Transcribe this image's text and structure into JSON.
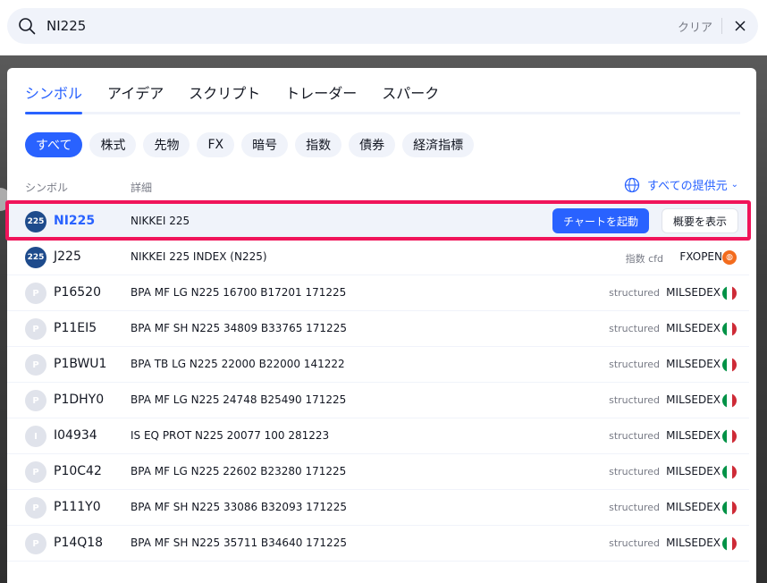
{
  "search": {
    "value": "NI225",
    "clear_label": "クリア"
  },
  "tabs": [
    {
      "label": "シンボル"
    },
    {
      "label": "アイデア"
    },
    {
      "label": "スクリプト"
    },
    {
      "label": "トレーダー"
    },
    {
      "label": "スパーク"
    }
  ],
  "filters": [
    {
      "label": "すべて"
    },
    {
      "label": "株式"
    },
    {
      "label": "先物"
    },
    {
      "label": "FX"
    },
    {
      "label": "暗号"
    },
    {
      "label": "指数"
    },
    {
      "label": "債券"
    },
    {
      "label": "経済指標"
    }
  ],
  "columns": {
    "symbol": "シンボル",
    "detail": "詳細",
    "provider": "すべての提供元"
  },
  "actions": {
    "launch_chart": "チャートを起動",
    "overview": "概要を表示"
  },
  "rows": [
    {
      "badge": "225",
      "symbol": "NI225",
      "desc": "NIKKEI 225",
      "type": "",
      "exchange": ""
    },
    {
      "badge": "225",
      "symbol": "J225",
      "desc": "NIKKEI 225 INDEX (N225)",
      "type": "指数 cfd",
      "exchange": "FXOPEN"
    },
    {
      "badge": "P",
      "symbol": "P16520",
      "desc": "BPA MF LG N225 16700 B17201 171225",
      "type": "structured",
      "exchange": "MILSEDEX"
    },
    {
      "badge": "P",
      "symbol": "P11EI5",
      "desc": "BPA MF SH N225 34809 B33765 171225",
      "type": "structured",
      "exchange": "MILSEDEX"
    },
    {
      "badge": "P",
      "symbol": "P1BWU1",
      "desc": "BPA TB LG N225 22000 B22000 141222",
      "type": "structured",
      "exchange": "MILSEDEX"
    },
    {
      "badge": "P",
      "symbol": "P1DHY0",
      "desc": "BPA MF LG N225 24748 B25490 171225",
      "type": "structured",
      "exchange": "MILSEDEX"
    },
    {
      "badge": "I",
      "symbol": "I04934",
      "desc": "IS EQ PROT N225 20077 100 281223",
      "type": "structured",
      "exchange": "MILSEDEX"
    },
    {
      "badge": "P",
      "symbol": "P10C42",
      "desc": "BPA MF LG N225 22602 B23280 171225",
      "type": "structured",
      "exchange": "MILSEDEX"
    },
    {
      "badge": "P",
      "symbol": "P111Y0",
      "desc": "BPA MF SH N225 33086 B32093 171225",
      "type": "structured",
      "exchange": "MILSEDEX"
    },
    {
      "badge": "P",
      "symbol": "P14Q18",
      "desc": "BPA MF SH N225 35711 B34640 171225",
      "type": "structured",
      "exchange": "MILSEDEX"
    }
  ],
  "colors": {
    "accent": "#2962ff",
    "highlight": "#f0145a"
  }
}
